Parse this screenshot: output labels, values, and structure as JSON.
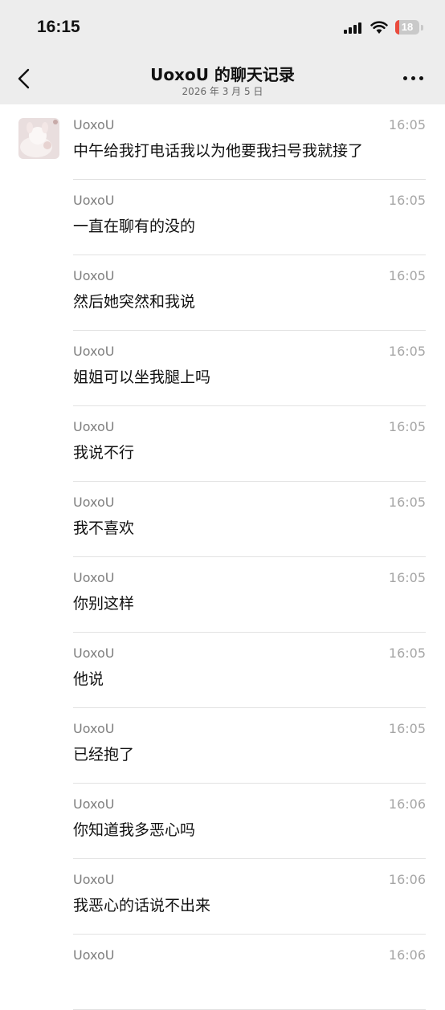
{
  "status_bar": {
    "time": "16:15",
    "battery": "18",
    "battery_fraction": 0.18
  },
  "header": {
    "title": "UoxoU 的聊天记录",
    "subtitle": "2026 年 3 月 5 日",
    "back_icon": "chevron-left-icon",
    "more_icon": "more-dots-icon"
  },
  "messages": [
    {
      "sender": "UoxoU",
      "time": "16:05",
      "text": "中午给我打电话我以为他要我扫号我就接了"
    },
    {
      "sender": "UoxoU",
      "time": "16:05",
      "text": "一直在聊有的没的"
    },
    {
      "sender": "UoxoU",
      "time": "16:05",
      "text": "然后她突然和我说"
    },
    {
      "sender": "UoxoU",
      "time": "16:05",
      "text": "姐姐可以坐我腿上吗"
    },
    {
      "sender": "UoxoU",
      "time": "16:05",
      "text": "我说不行"
    },
    {
      "sender": "UoxoU",
      "time": "16:05",
      "text": "我不喜欢"
    },
    {
      "sender": "UoxoU",
      "time": "16:05",
      "text": "你别这样"
    },
    {
      "sender": "UoxoU",
      "time": "16:05",
      "text": "他说"
    },
    {
      "sender": "UoxoU",
      "time": "16:05",
      "text": "已经抱了"
    },
    {
      "sender": "UoxoU",
      "time": "16:06",
      "text": "你知道我多恶心吗"
    },
    {
      "sender": "UoxoU",
      "time": "16:06",
      "text": "我恶心的话说不出来"
    },
    {
      "sender": "UoxoU",
      "time": "16:06",
      "text": ""
    }
  ]
}
